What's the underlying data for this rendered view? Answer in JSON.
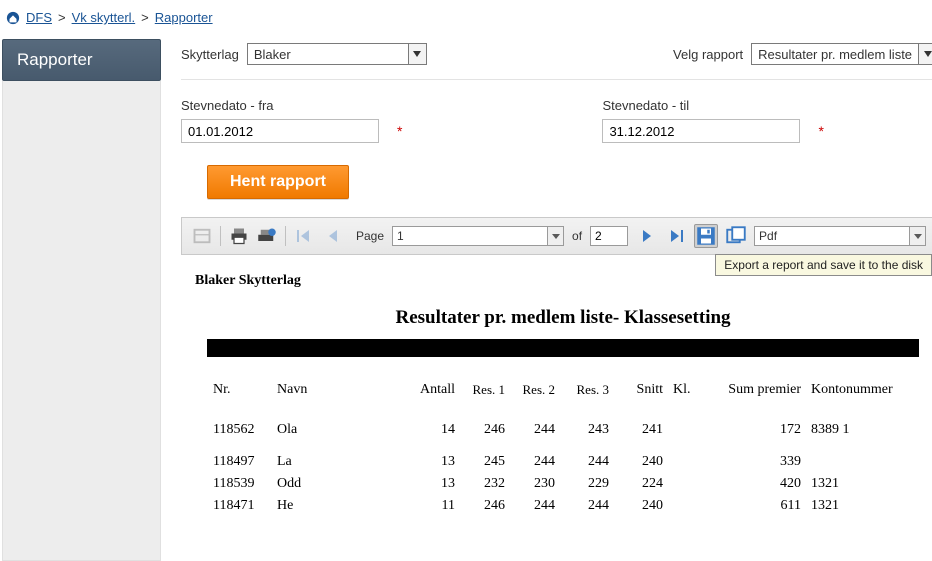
{
  "breadcrumb": {
    "items": [
      "DFS",
      "Vk skytterl.",
      "Rapporter"
    ]
  },
  "sidebar": {
    "title": "Rapporter"
  },
  "filters": {
    "skytterlag_label": "Skytterlag",
    "skytterlag_value": "Blaker",
    "velg_label": "Velg rapport",
    "velg_value": "Resultater pr. medlem liste"
  },
  "dates": {
    "from_label": "Stevnedato - fra",
    "from_value": "01.01.2012",
    "to_label": "Stevnedato - til",
    "to_value": "31.12.2012"
  },
  "actions": {
    "hent_label": "Hent rapport"
  },
  "toolbar": {
    "page_label": "Page",
    "page_value": "1",
    "of_label": "of",
    "page_count": "2",
    "export_format": "Pdf",
    "tooltip": "Export a report and save it to the disk"
  },
  "report": {
    "org": "Blaker Skytterlag",
    "title": "Resultater pr. medlem liste- Klassesetting",
    "headers": {
      "nr": "Nr.",
      "navn": "Navn",
      "antall": "Antall",
      "res1": "Res. 1",
      "res2": "Res. 2",
      "res3": "Res. 3",
      "snitt": "Snitt",
      "kl": "Kl.",
      "sum": "Sum premier",
      "konto": "Kontonummer"
    },
    "rows": [
      {
        "nr": "118562",
        "navn": "Ola",
        "antall": "14",
        "r1": "246",
        "r2": "244",
        "r3": "243",
        "snitt": "241",
        "kl": "",
        "sum": "172",
        "konto": "8389 1"
      },
      {
        "nr": "118497",
        "navn": "La",
        "antall": "13",
        "r1": "245",
        "r2": "244",
        "r3": "244",
        "snitt": "240",
        "kl": "",
        "sum": "339",
        "konto": ""
      },
      {
        "nr": "118539",
        "navn": "Odd",
        "antall": "13",
        "r1": "232",
        "r2": "230",
        "r3": "229",
        "snitt": "224",
        "kl": "",
        "sum": "420",
        "konto": "1321"
      },
      {
        "nr": "118471",
        "navn": "He",
        "antall": "11",
        "r1": "246",
        "r2": "244",
        "r3": "244",
        "snitt": "240",
        "kl": "",
        "sum": "611",
        "konto": "1321"
      }
    ]
  }
}
